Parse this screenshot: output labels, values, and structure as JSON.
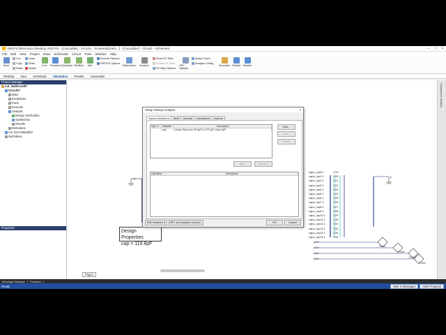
{
  "window": {
    "title": "ANSYS Electronics Desktop 2020 R2 - [CutLadder] - Circuit1 - Schematic[Hem...] - [CutLadder] - Circuit1 - Schematic"
  },
  "menu": [
    "File",
    "Edit",
    "View",
    "Project",
    "Draw",
    "Schematic",
    "Circuit",
    "Tools",
    "Window",
    "Help"
  ],
  "ribbon": {
    "save": "Save",
    "cut": "Cut",
    "copy": "Copy",
    "paste": "Paste",
    "undo": "Undo",
    "redo": "Redo",
    "delete": "Delete",
    "buttons": [
      "Line",
      "Transient",
      "QuickEye",
      "VerifEye",
      "AMI"
    ],
    "remote_options": "Remote Options",
    "hspice_options": "HSPICE Options",
    "optimetrics": "Optimetrics",
    "analyze": "Analyze",
    "show_dc_bias": "Show DC Bias",
    "update_dc_bias": "Update DC Bias",
    "dc_bias_options": "DC Bias Options",
    "hpc_options": "HPC Options",
    "ansys_cloud": "Ansys Cloud",
    "analysis_config": "Analysis Config",
    "simulator": "Simulator",
    "submit": "Submit",
    "monitor": "Monitor"
  },
  "ribbon_tabs": [
    "Desktop",
    "View",
    "Schematic",
    "Simulation",
    "Results",
    "Automation"
  ],
  "project_manager": {
    "title": "Project Manager",
    "items": [
      "cut_ladder.aedt*",
      "Circuit1*",
      "Data",
      "Excitations",
      "Ports",
      "Ecircuits",
      "Analysis",
      "Design Verification",
      "Optimetrics",
      "Results",
      "Definitions",
      "Cut (CircuitModel)*",
      "Definitions"
    ]
  },
  "properties": {
    "title": "Properties"
  },
  "statusbar": {
    "tabs": [
      "Message Manager",
      "Progress"
    ],
    "status": "Ready",
    "hide_messages": "Hide 4 Messages",
    "hide_progress": "Hide Progress"
  },
  "page_tab": "Page1",
  "design_properties": {
    "title": "Design Properties",
    "value": "cap = 119.8pF"
  },
  "schematic": {
    "parts": [
      "caps_lop0:1",
      "caps_lop1:1",
      "caps_lop2:1",
      "caps_lop3:1",
      "caps_lop4:1",
      "caps_lop5:1",
      "caps_lop6:1",
      "caps_lop7:1",
      "caps_lop8:1",
      "caps_lop9:1",
      "caps_lop10:1",
      "caps_lop11:1",
      "caps_lop12:1",
      "caps_lop13:1",
      "caps_lop14:1",
      "caps_lop15:1"
    ],
    "cnames": [
      "C19",
      "C20",
      "C21",
      "C22",
      "C23",
      "C24",
      "C25",
      "C26",
      "C27",
      "C28",
      "C29",
      "C30",
      "C31",
      "C32",
      "C33",
      "C34"
    ],
    "ports": [
      "p1:1",
      "p2:1",
      "p3:1",
      "p4:1"
    ],
    "port_labels": [
      "Port1",
      "Port2",
      "Port3",
      "Port4"
    ]
  },
  "dialog": {
    "title": "Setup Sweep Analysis",
    "tabs": [
      "Sweep Definitions",
      "Table",
      "General",
      "Calculations",
      "Options"
    ],
    "var_headers": [
      "Sync #",
      "Variable",
      "Description"
    ],
    "var_row": {
      "sync": "",
      "variable": "cap",
      "description": "Linear Step from 59.6pF to 179.4pF, step=4pF"
    },
    "add": "Add...",
    "edit": "Edit...",
    "delete": "Delete",
    "sync": "Sync",
    "unsync": "UnSync",
    "op_headers": [
      "Operation",
      "Description"
    ],
    "edit_variables": "Edit Variables",
    "hpc": "HPC and Analysis Options...",
    "ok": "OK",
    "cancel": "Cancel"
  }
}
